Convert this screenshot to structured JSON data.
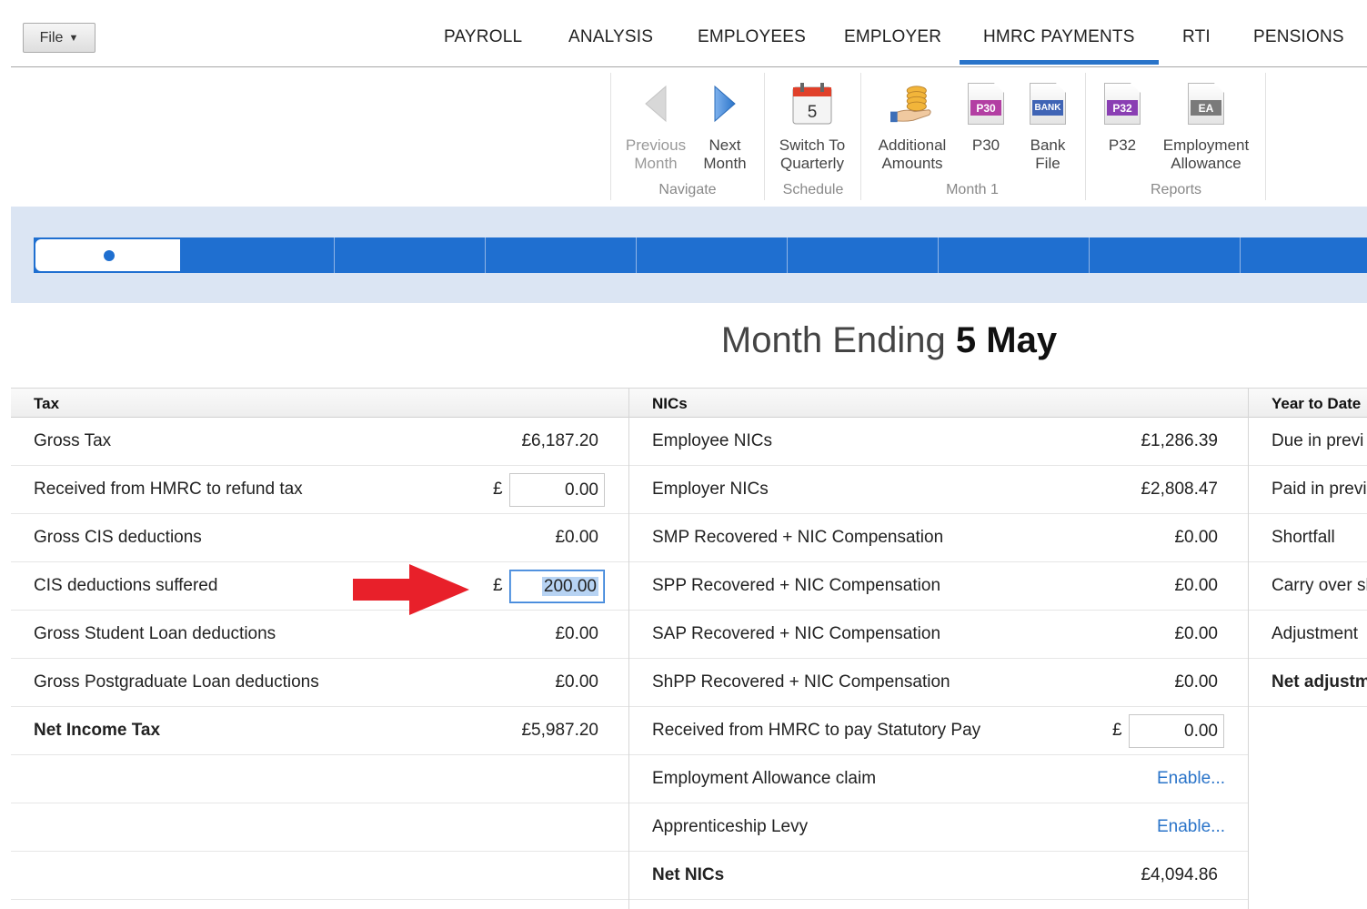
{
  "file_menu": {
    "label": "File"
  },
  "nav": {
    "tabs": [
      "PAYROLL",
      "ANALYSIS",
      "EMPLOYEES",
      "EMPLOYER",
      "HMRC PAYMENTS",
      "RTI",
      "PENSIONS"
    ],
    "active": "HMRC PAYMENTS"
  },
  "ribbon": {
    "previous_month": [
      "Previous",
      "Month"
    ],
    "next_month": [
      "Next",
      "Month"
    ],
    "switch_quarterly": [
      "Switch To",
      "Quarterly"
    ],
    "calendar_day": "5",
    "additional_amounts": [
      "Additional",
      "Amounts"
    ],
    "p30": "P30",
    "bank_file": [
      "Bank",
      "File"
    ],
    "p32": "P32",
    "employment_allowance": [
      "Employment",
      "Allowance"
    ],
    "icon_tags": {
      "p30": "P30",
      "bank": "BANK",
      "p32": "P32",
      "ea": "EA"
    },
    "groups": {
      "navigate": "Navigate",
      "schedule": "Schedule",
      "month": "Month 1",
      "reports": "Reports"
    }
  },
  "title": {
    "prefix": "Month Ending",
    "date": "5 May"
  },
  "tax": {
    "header": "Tax",
    "rows": [
      {
        "label": "Gross Tax",
        "value": "£6,187.20"
      },
      {
        "label": "Received from HMRC to refund tax",
        "currency": "£",
        "input": "0.00"
      },
      {
        "label": "Gross CIS deductions",
        "value": "£0.00"
      },
      {
        "label": "CIS deductions suffered",
        "currency": "£",
        "input": "200.00"
      },
      {
        "label": "Gross Student Loan deductions",
        "value": "£0.00"
      },
      {
        "label": "Gross Postgraduate Loan deductions",
        "value": "£0.00"
      },
      {
        "label": "Net Income Tax",
        "value": "£5,987.20"
      }
    ]
  },
  "nics": {
    "header": "NICs",
    "rows": [
      {
        "label": "Employee NICs",
        "value": "£1,286.39"
      },
      {
        "label": "Employer NICs",
        "value": "£2,808.47"
      },
      {
        "label": "SMP Recovered + NIC Compensation",
        "value": "£0.00"
      },
      {
        "label": "SPP Recovered + NIC Compensation",
        "value": "£0.00"
      },
      {
        "label": "SAP Recovered + NIC Compensation",
        "value": "£0.00"
      },
      {
        "label": "ShPP Recovered + NIC Compensation",
        "value": "£0.00"
      },
      {
        "label": "Received from HMRC to pay Statutory Pay",
        "currency": "£",
        "input": "0.00"
      },
      {
        "label": "Employment Allowance claim",
        "link": "Enable..."
      },
      {
        "label": "Apprenticeship Levy",
        "link": "Enable..."
      },
      {
        "label": "Net NICs",
        "value": "£4,094.86"
      }
    ]
  },
  "ytd": {
    "header": "Year to Date",
    "rows": [
      "Due in previ",
      "Paid in previ",
      "Shortfall",
      "Carry over sh",
      "Adjustment",
      "Net adjustm"
    ]
  },
  "colors": {
    "accent": "#2a74c9",
    "track": "#1f6fd0",
    "arrow": "#e8202a"
  }
}
